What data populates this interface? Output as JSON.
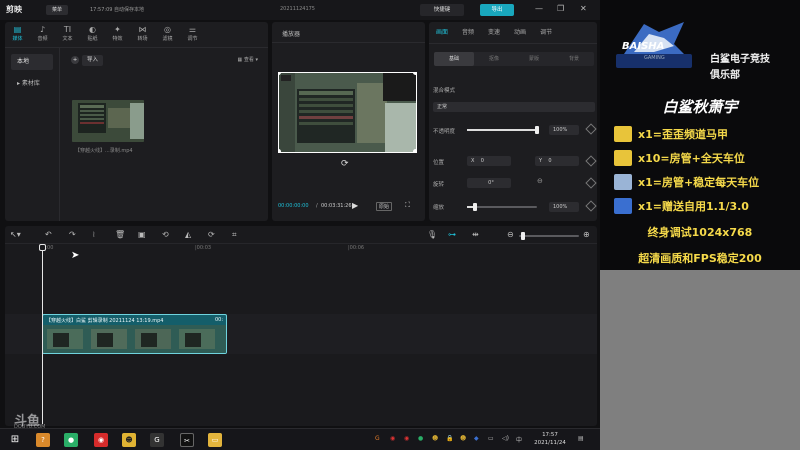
{
  "titlebar": {
    "app_name": "剪映",
    "menu_label": "菜单",
    "autosave_status": "17:57:09 自动保存本地",
    "project_name": "20211124175",
    "shortcut_label": "快捷键",
    "export_label": "导出"
  },
  "media": {
    "tabs": [
      {
        "icon": "▤",
        "label": "媒体",
        "icon_name": "media-icon"
      },
      {
        "icon": "♪",
        "label": "音频",
        "icon_name": "audio-icon"
      },
      {
        "icon": "TI",
        "label": "文本",
        "icon_name": "text-icon"
      },
      {
        "icon": "◐",
        "label": "贴纸",
        "icon_name": "sticker-icon"
      },
      {
        "icon": "✦",
        "label": "特效",
        "icon_name": "effects-icon"
      },
      {
        "icon": "⋈",
        "label": "转场",
        "icon_name": "transition-icon"
      },
      {
        "icon": "◎",
        "label": "滤镜",
        "icon_name": "filter-icon"
      },
      {
        "icon": "⚌",
        "label": "调节",
        "icon_name": "adjust-icon"
      }
    ],
    "side_items": [
      "本地",
      "素材库"
    ],
    "import_label": "导入",
    "sort_label": "查看",
    "clip_name": "【穿越火线】...录制.mp4",
    "thumb_time": "00:03:31"
  },
  "player": {
    "title": "播放器",
    "current_time": "00:00:00:00",
    "total_time": "00:03:31:26",
    "ratio_label": "原始"
  },
  "properties": {
    "tabs": [
      "画面",
      "音频",
      "变速",
      "动画",
      "调节"
    ],
    "subtabs": [
      "基础",
      "抠像",
      "蒙版",
      "背景"
    ],
    "blend_label": "混合模式",
    "blend_value": "正常",
    "opacity_label": "不透明度",
    "opacity_value": "100%",
    "opacity_level": 1.0,
    "position_label": "位置",
    "pos_x_label": "X",
    "pos_x_value": "0",
    "pos_y_label": "Y",
    "pos_y_value": "0",
    "rotate_label": "旋转",
    "rotate_value": "0°",
    "scale_label": "缩放",
    "scale_value": "100%",
    "scale_level": 0.12
  },
  "timeline": {
    "ruler": [
      "00:00",
      "|00:03",
      "|00:06"
    ],
    "clip_label": "【穿越火线】白鲨 剪辑录制 20211124 13:19.mp4",
    "clip_duration": "00:"
  },
  "taskbar": {
    "clock_time": "17:57",
    "clock_date": "2021/11/24",
    "ime_label": "中"
  },
  "promo": {
    "club_name_line1": "白鲨电子竞技",
    "club_name_line2": "俱乐部",
    "logo_text": "BAISHA",
    "logo_sub": "GAMING",
    "streamer": "白鲨秋萧宇",
    "rows": [
      {
        "text": "x1=歪歪频道马甲",
        "color": "#e8c43a"
      },
      {
        "text": "x10=房管+全天车位",
        "color": "#e8c43a"
      },
      {
        "text": "x1=房管+稳定每天车位",
        "color": "#9ab4d6"
      },
      {
        "text": "x1=赠送自用1.1/3.0",
        "color": "#3a6fd0"
      }
    ],
    "line1": "终身调试1024x768",
    "line2": "超清画质和FPS稳定200"
  },
  "watermark": {
    "brand": "斗鱼",
    "sub": "DOUYU.COM"
  }
}
